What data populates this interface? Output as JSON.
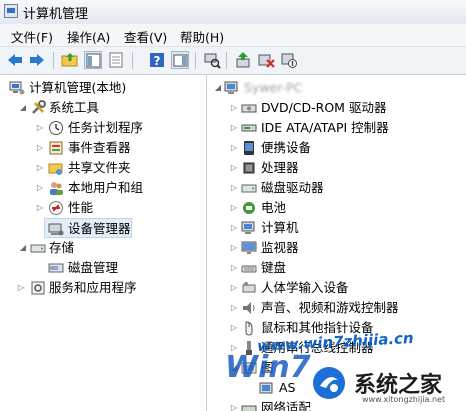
{
  "window": {
    "title": "计算机管理"
  },
  "menu": {
    "items": [
      "文件(F)",
      "操作(A)",
      "查看(V)",
      "帮助(H)"
    ]
  },
  "toolbar": {
    "buttons": [
      "back-icon",
      "forward-icon",
      "up-folder-icon",
      "show-tree-icon",
      "properties-icon",
      "help-icon",
      "view-icon",
      "scan-hardware-icon",
      "update-driver-icon",
      "uninstall-icon",
      "disable-icon"
    ]
  },
  "left_tree": {
    "root": "计算机管理(本地)",
    "system_tools": "系统工具",
    "task_scheduler": "任务计划程序",
    "event_viewer": "事件查看器",
    "shared_folders": "共享文件夹",
    "local_users": "本地用户和组",
    "performance": "性能",
    "device_manager": "设备管理器",
    "storage": "存储",
    "disk_management": "磁盘管理",
    "services_apps": "服务和应用程序"
  },
  "devices": {
    "computer_name": "Sywer-PC",
    "items": [
      "DVD/CD-ROM 驱动器",
      "IDE ATA/ATAPI 控制器",
      "便携设备",
      "处理器",
      "磁盘驱动器",
      "电池",
      "计算机",
      "监视器",
      "键盘",
      "人体学输入设备",
      "声音、视频和游戏控制器",
      "鼠标和其他指针设备",
      "通用串行总线控制器",
      "图",
      "AS",
      "网络适配"
    ]
  },
  "watermark": {
    "url": "www.win7zhijia.cn",
    "brand": "系统之家",
    "sub": "Win7",
    "small": "www.xitongzhijia.net"
  }
}
